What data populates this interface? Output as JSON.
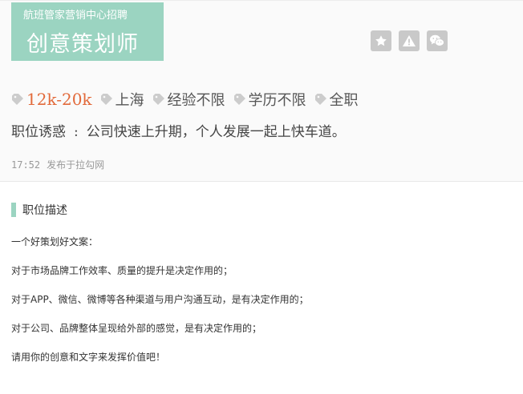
{
  "header": {
    "company": "航班管家营销中心招聘",
    "job_title": "创意策划师"
  },
  "actions": [
    {
      "name": "favorite",
      "icon": "star-icon"
    },
    {
      "name": "report",
      "icon": "warning-icon"
    },
    {
      "name": "share",
      "icon": "wechat-icon"
    }
  ],
  "tags": {
    "salary": "12k-20k",
    "city": "上海",
    "experience": "经验不限",
    "education": "学历不限",
    "job_type": "全职"
  },
  "perk": {
    "label": "职位诱惑",
    "separator": ":",
    "text": "公司快速上升期，个人发展一起上快车道。"
  },
  "meta": {
    "time": "17:52",
    "source": "发布于拉勾网"
  },
  "section": {
    "title": "职位描述"
  },
  "description": [
    "一个好策划好文案：",
    "对于市场品牌工作效率、质量的提升是决定作用的；",
    "对于APP、微信、微博等各种渠道与用户沟通互动，是有决定作用的；",
    "对于公司、品牌整体呈现给外部的感觉，是有决定作用的；",
    "请用你的创意和文字来发挥价值吧！"
  ],
  "colors": {
    "accent": "#9bd4c1",
    "salary": "#e26a3b",
    "icon_bg": "#c9c9c9",
    "tag_icon": "#cccccc"
  }
}
